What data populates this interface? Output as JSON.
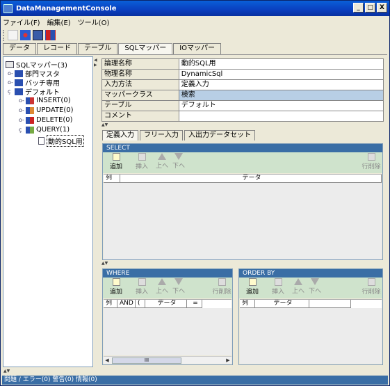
{
  "window": {
    "title": "DataManagementConsole",
    "min": "_",
    "max": "□",
    "close": "X"
  },
  "menu": [
    "ファイル(F)",
    "編集(E)",
    "ツール(O)"
  ],
  "tabs": [
    "データ",
    "レコード",
    "テーブル",
    "SQLマッパー",
    "IOマッパー"
  ],
  "tree": {
    "root": "SQLマッパー(3)",
    "items": [
      "部門マスタ",
      "バッチ専用",
      "デフォルト"
    ],
    "queries": [
      "INSERT(0)",
      "UPDATE(0)",
      "DELETE(0)",
      "QUERY(1)"
    ],
    "selected": "動的SQL用"
  },
  "props": [
    {
      "k": "論理名称",
      "v": "動的SQL用"
    },
    {
      "k": "物理名称",
      "v": "DynamicSql"
    },
    {
      "k": "入力方法",
      "v": "定義入力"
    },
    {
      "k": "マッパークラス",
      "v": "検索"
    },
    {
      "k": "テーブル",
      "v": "デフォルト"
    },
    {
      "k": "コメント",
      "v": ""
    }
  ],
  "subtabs": [
    "定義入力",
    "フリー入力",
    "入出力データセット"
  ],
  "buttons": {
    "add": "追加",
    "insert": "挿入",
    "up": "上へ",
    "down": "下へ",
    "delete_row": "行削除"
  },
  "select": {
    "title": "SELECT",
    "cols": [
      "列",
      "データ"
    ]
  },
  "where": {
    "title": "WHERE",
    "cols": [
      "列",
      "AND",
      "(",
      "データ",
      "="
    ]
  },
  "orderby": {
    "title": "ORDER BY",
    "cols": [
      "列",
      "データ"
    ]
  },
  "scroll": {
    "thumb": "III"
  },
  "status": "問題 / エラー(0) 警告(0) 情報(0)"
}
